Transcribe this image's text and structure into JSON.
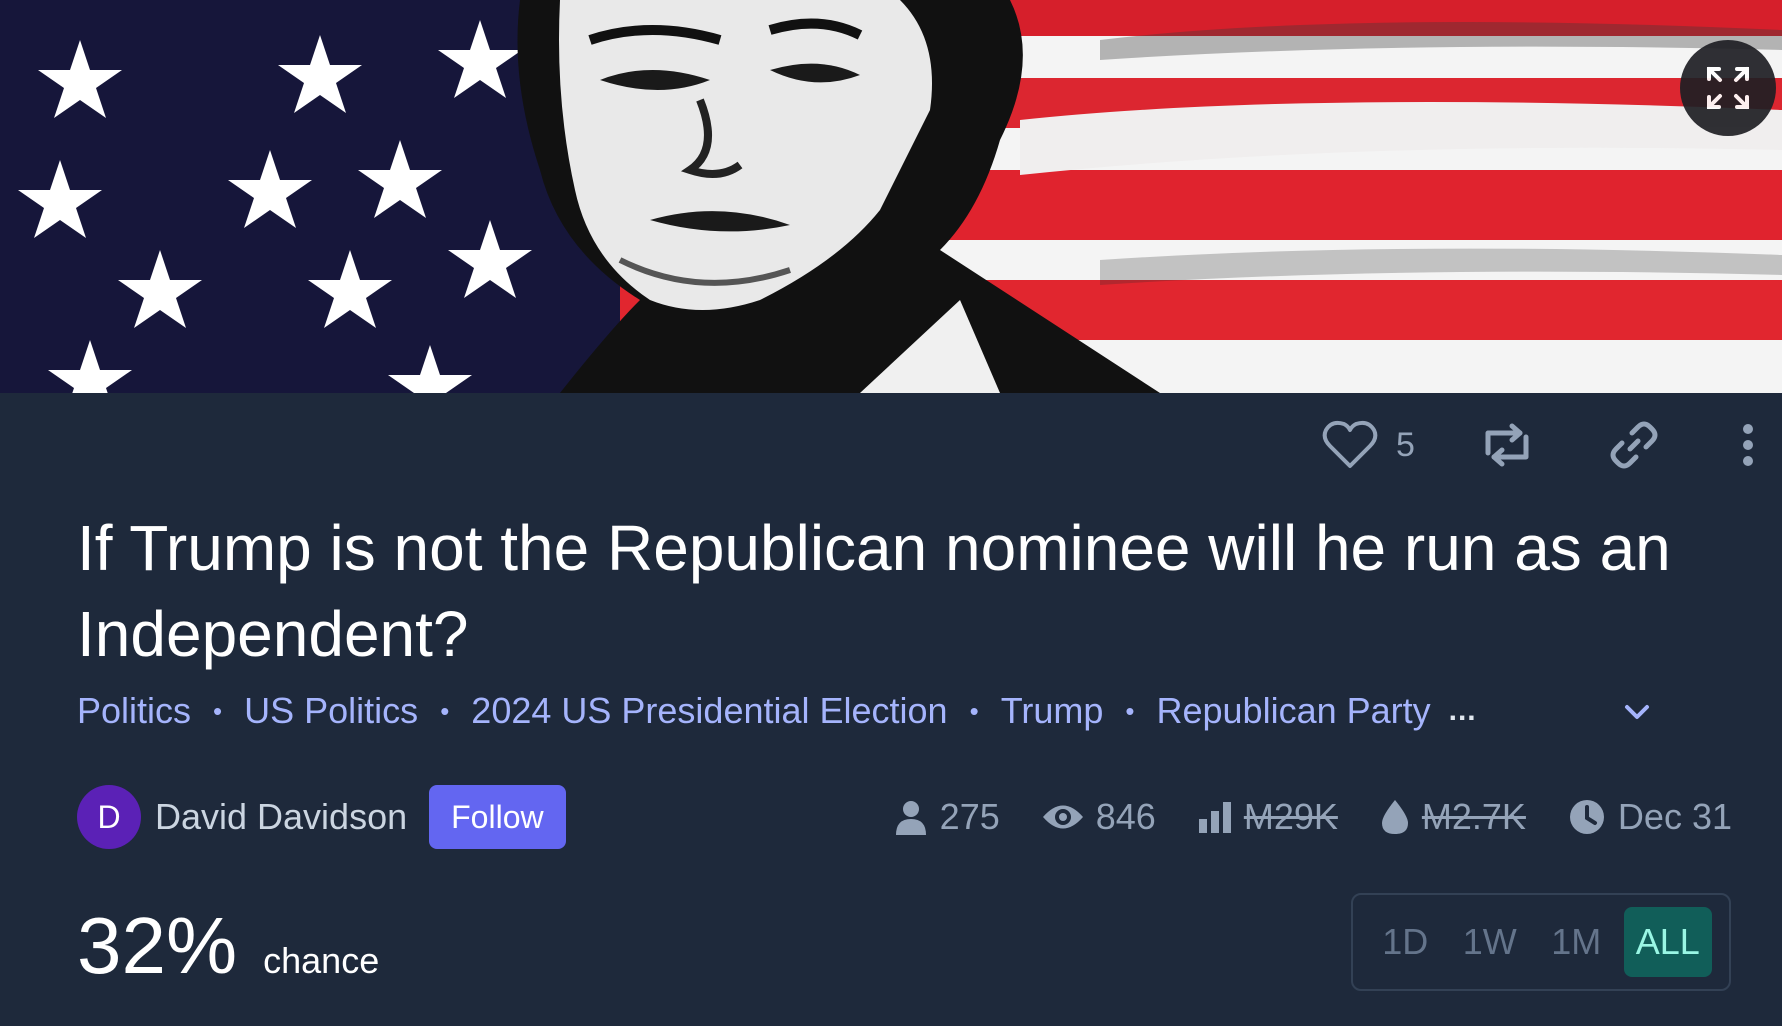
{
  "header": {
    "banner_image": "us-flag-portrait-image",
    "expand_icon": "expand-icon"
  },
  "actions": {
    "like_icon": "heart-icon",
    "like_count": "5",
    "repost_icon": "repost-icon",
    "link_icon": "link-icon",
    "more_icon": "vertical-dots-icon"
  },
  "market": {
    "title": "If Trump is not the Republican nominee will he run as an Independent?",
    "tags": [
      "Politics",
      "US Politics",
      "2024 US Presidential Election",
      "Trump",
      "Republican Party"
    ],
    "tags_more": "..."
  },
  "creator": {
    "avatar_letter": "D",
    "name": "David Davidson",
    "follow_label": "Follow"
  },
  "stats": {
    "traders": "275",
    "views": "846",
    "volume": "M29K",
    "liquidity": "M2.7K",
    "close_date": "Dec 31"
  },
  "probability": {
    "value": "32%",
    "label": "chance"
  },
  "time_range": {
    "options": [
      "1D",
      "1W",
      "1M",
      "ALL"
    ],
    "selected": "ALL"
  },
  "colors": {
    "background": "#1e293b",
    "accent": "#6366f1",
    "tag_link": "#a5b4fc",
    "range_active_bg": "#115e59",
    "range_active_text": "#99f6e4"
  }
}
